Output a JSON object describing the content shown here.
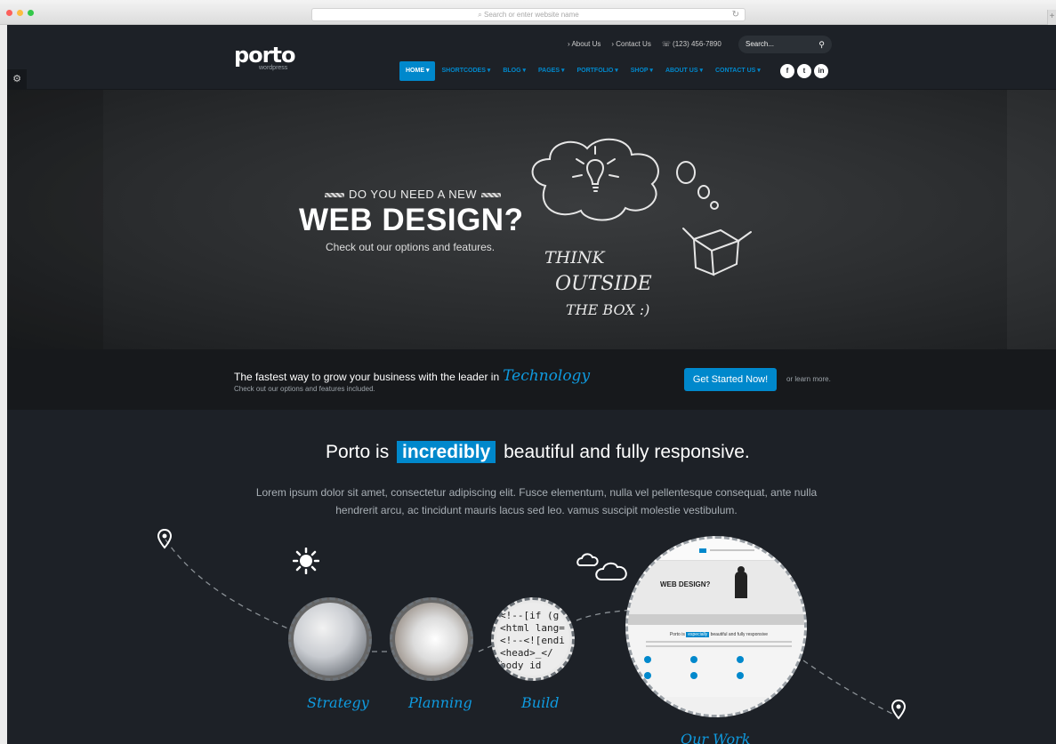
{
  "browser": {
    "address_placeholder": "Search or enter website name",
    "colors": {
      "close": "#fc605b",
      "minimize": "#fdbc40",
      "zoom": "#34c84a"
    }
  },
  "header": {
    "logo": "porto",
    "logo_sub": "wordpress",
    "top_links": [
      "› About Us",
      "› Contact Us",
      "☏ (123) 456-7890"
    ],
    "search_placeholder": "Search...",
    "nav": [
      "HOME ▾",
      "SHORTCODES ▾",
      "BLOG ▾",
      "PAGES ▾",
      "PORTFOLIO ▾",
      "SHOP ▾",
      "ABOUT US ▾",
      "CONTACT US ▾"
    ],
    "social": [
      "f",
      "t",
      "in"
    ]
  },
  "hero": {
    "kicker": "DO YOU NEED A NEW",
    "title": "WEB DESIGN?",
    "subtitle": "Check out our options and features.",
    "chalk_lines": [
      "THINK",
      "OUTSIDE",
      "THE BOX :)"
    ]
  },
  "cta": {
    "title": "The fastest way to grow your business with the leader in",
    "highlight": "Technology",
    "subtitle": "Check out our options and features included.",
    "button": "Get Started Now!",
    "more": "or learn more."
  },
  "main": {
    "headline_pre": "Porto is",
    "headline_hl": "incredibly",
    "headline_post": "beautiful and fully responsive.",
    "lead": "Lorem ipsum dolor sit amet, consectetur adipiscing elit. Fusce elementum, nulla vel pellentesque consequat, ante nulla hendrerit arcu, ac tincidunt mauris lacus sed leo. vamus suscipit molestie vestibulum.",
    "steps": [
      "Strategy",
      "Planning",
      "Build",
      "Our Work"
    ],
    "build_code": [
      "<!--[if (g",
      "<html lang=",
      "<!--<![endi",
      "<head>_</",
      " body id"
    ],
    "preview": {
      "title": "WEB DESIGN?",
      "headline_pre": "Porto is",
      "headline_hl": "especially",
      "headline_post": "beautiful and fully responsive"
    }
  },
  "colors": {
    "accent": "#0088cc",
    "bg": "#1d2127"
  }
}
